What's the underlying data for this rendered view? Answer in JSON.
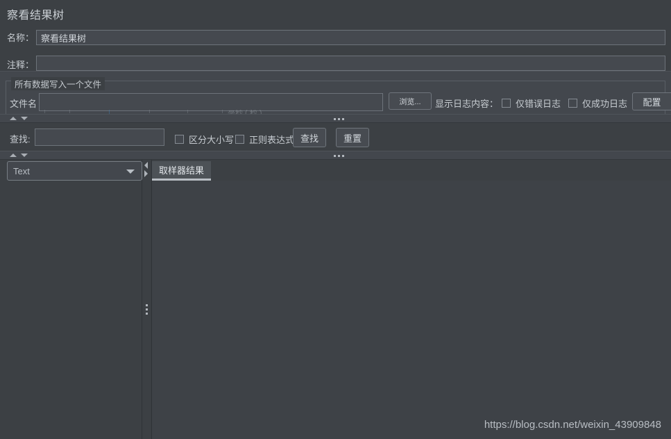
{
  "window": {
    "title": "察看结果树",
    "watermark": "https://blog.csdn.net/weixin_43909848"
  },
  "form": {
    "name_label": "名称：",
    "name_value": "察看结果树",
    "comment_label": "注释：",
    "comment_value": "",
    "comment_placeholder": ""
  },
  "file_group": {
    "legend": "所有数据写入一个文件",
    "filename_label": "文件名",
    "filename_value": "",
    "browse_button": "浏览...",
    "log_content_label": "显示日志内容：",
    "errors_only_checkbox": "仅错误日志",
    "success_only_checkbox": "仅成功日志",
    "configure_button": "配置",
    "ghost_text": "毫秒 ( 秒 )"
  },
  "search_bar": {
    "label": "查找:",
    "value": "",
    "case_sensitive_checkbox": "区分大小写",
    "regex_checkbox": "正则表达式",
    "find_button": "查找",
    "reset_button": "重置"
  },
  "viewer": {
    "renderer_selected": "Text",
    "renderer_options": [
      "Text"
    ],
    "tabs": [
      {
        "label": "取样器结果",
        "active": true
      }
    ],
    "content": ""
  },
  "colors": {
    "background": "#3c4044",
    "panel": "#43474d",
    "field": "#45494f",
    "border": "#6d737a",
    "text": "#c7ccd1",
    "tab_active": "#4d5257",
    "tab_underline": "#b9bec4"
  }
}
